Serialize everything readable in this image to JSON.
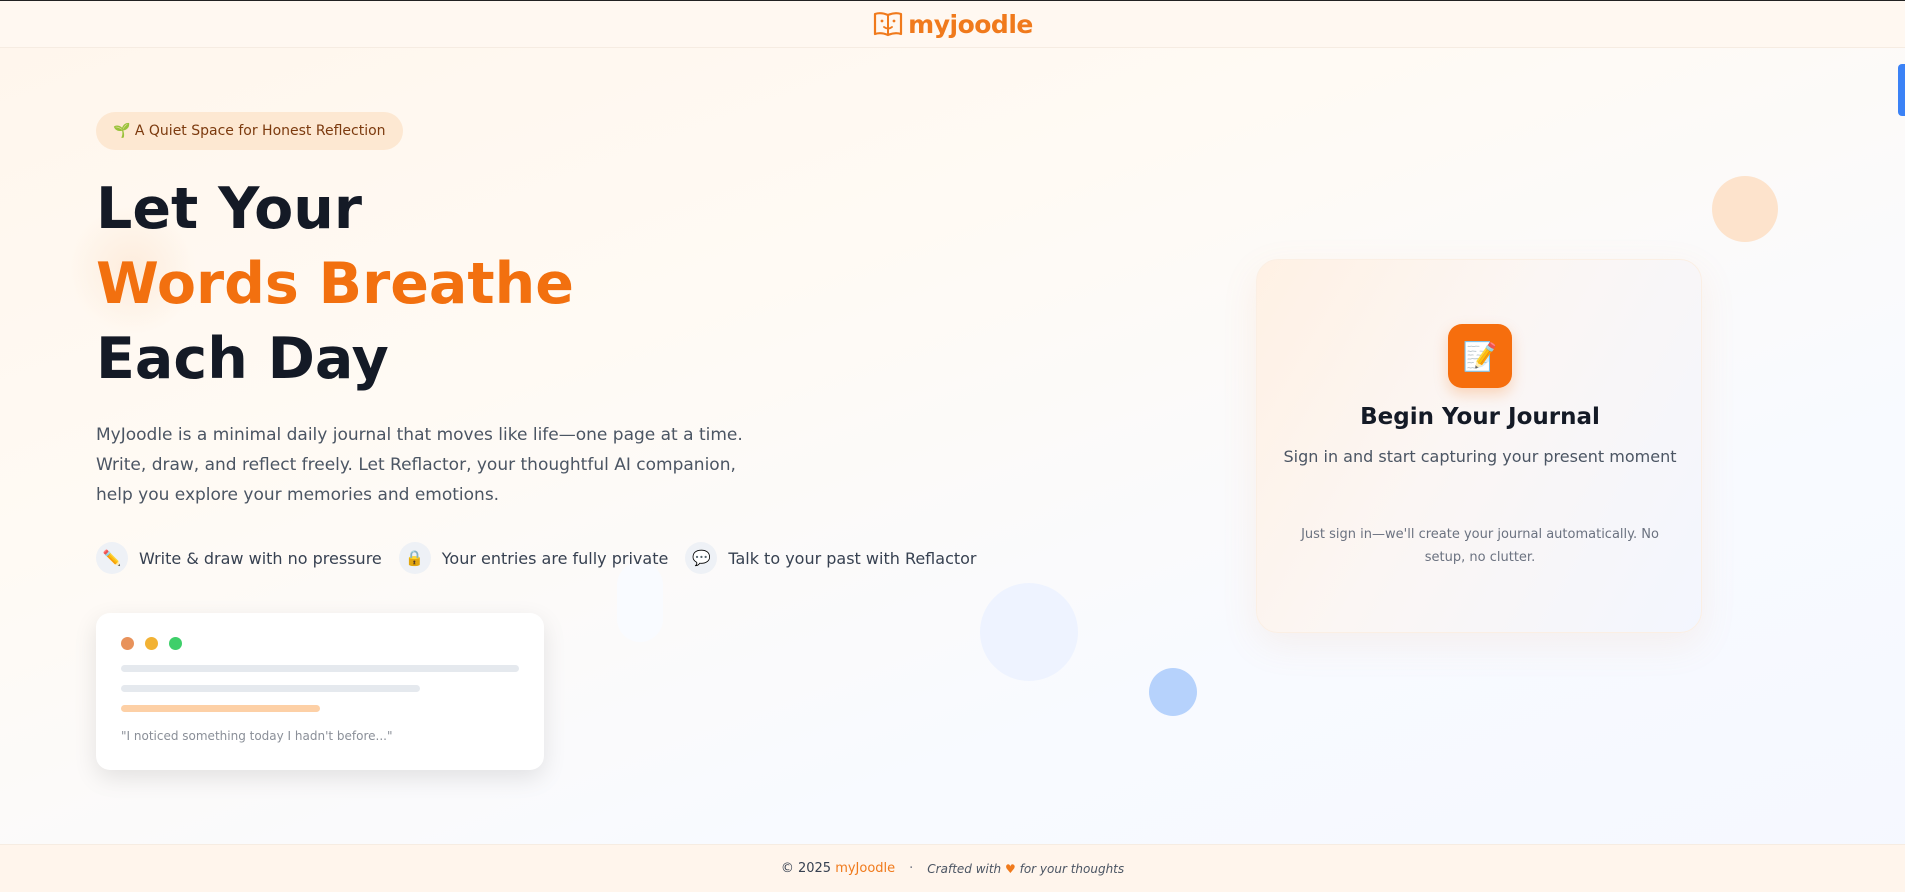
{
  "header": {
    "logo_text": "myjoodle",
    "logo_icon": "open-book-face-icon"
  },
  "hero": {
    "tagline": "🌱 A Quiet Space for Honest Reflection",
    "headline_line1": "Let Your",
    "headline_accent": "Words Breathe",
    "headline_line3": "Each Day",
    "description": "MyJoodle is a minimal daily journal that moves like life—one page at a time. Write, draw, and reflect freely. Let Reflactor, your thoughtful AI companion, help you explore your memories and emotions.",
    "features": [
      {
        "icon": "✏️",
        "icon_name": "pencil-icon",
        "label": "Write & draw with no pressure"
      },
      {
        "icon": "🔒",
        "icon_name": "lock-icon",
        "label": "Your entries are fully private"
      },
      {
        "icon": "💬",
        "icon_name": "speech-bubble-icon",
        "label": "Talk to your past with Reflactor"
      }
    ]
  },
  "preview_card": {
    "quote": "\"I noticed something today I hadn't before...\"",
    "dot_colors": [
      "#e8925b",
      "#f2b234",
      "#3ecf6a"
    ]
  },
  "journal_card": {
    "icon": "📝",
    "icon_name": "memo-icon",
    "title": "Begin Your Journal",
    "subtitle": "Sign in and start capturing your present moment",
    "note": "Just sign in—we'll create your journal automatically. No setup, no clutter."
  },
  "footer": {
    "copyright": "© 2025",
    "brand": "myJoodle",
    "separator": "·",
    "crafted_prefix": "Crafted with",
    "heart": "♥",
    "crafted_suffix": "for your thoughts"
  },
  "colors": {
    "accent": "#f2700f",
    "headline": "#141a26",
    "scroll_indicator": "#3b82f6"
  }
}
